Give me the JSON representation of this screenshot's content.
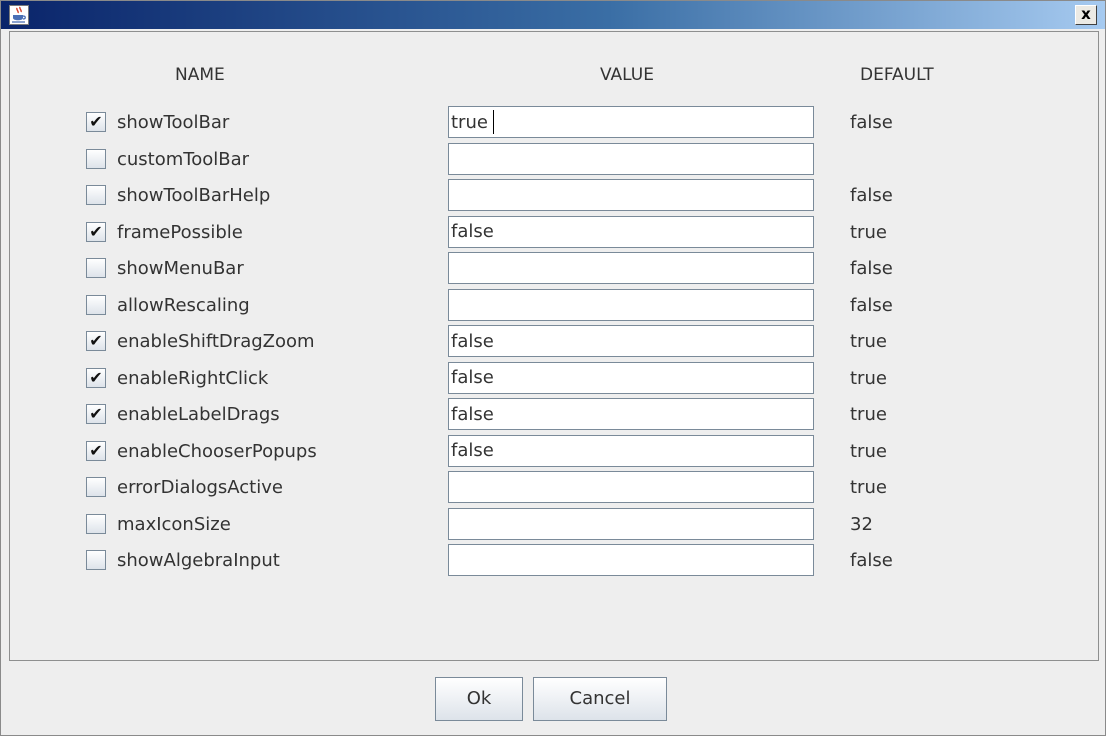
{
  "window": {
    "icon": "java-coffee-cup-icon",
    "close_label": "x"
  },
  "headers": {
    "name": "NAME",
    "value": "VALUE",
    "default": "DEFAULT"
  },
  "rows": [
    {
      "name": "showToolBar",
      "checked": true,
      "value": "true",
      "default": "false"
    },
    {
      "name": "customToolBar",
      "checked": false,
      "value": "",
      "default": ""
    },
    {
      "name": "showToolBarHelp",
      "checked": false,
      "value": "",
      "default": "false"
    },
    {
      "name": "framePossible",
      "checked": true,
      "value": "false",
      "default": "true"
    },
    {
      "name": "showMenuBar",
      "checked": false,
      "value": "",
      "default": "false"
    },
    {
      "name": "allowRescaling",
      "checked": false,
      "value": "",
      "default": "false"
    },
    {
      "name": "enableShiftDragZoom",
      "checked": true,
      "value": "false",
      "default": "true"
    },
    {
      "name": "enableRightClick",
      "checked": true,
      "value": "false",
      "default": "true"
    },
    {
      "name": "enableLabelDrags",
      "checked": true,
      "value": "false",
      "default": "true"
    },
    {
      "name": "enableChooserPopups",
      "checked": true,
      "value": "false",
      "default": "true"
    },
    {
      "name": "errorDialogsActive",
      "checked": false,
      "value": "",
      "default": "true"
    },
    {
      "name": "maxIconSize",
      "checked": false,
      "value": "",
      "default": "32"
    },
    {
      "name": "showAlgebraInput",
      "checked": false,
      "value": "",
      "default": "false"
    }
  ],
  "buttons": {
    "ok": "Ok",
    "cancel": "Cancel"
  },
  "check_mark": "✔"
}
